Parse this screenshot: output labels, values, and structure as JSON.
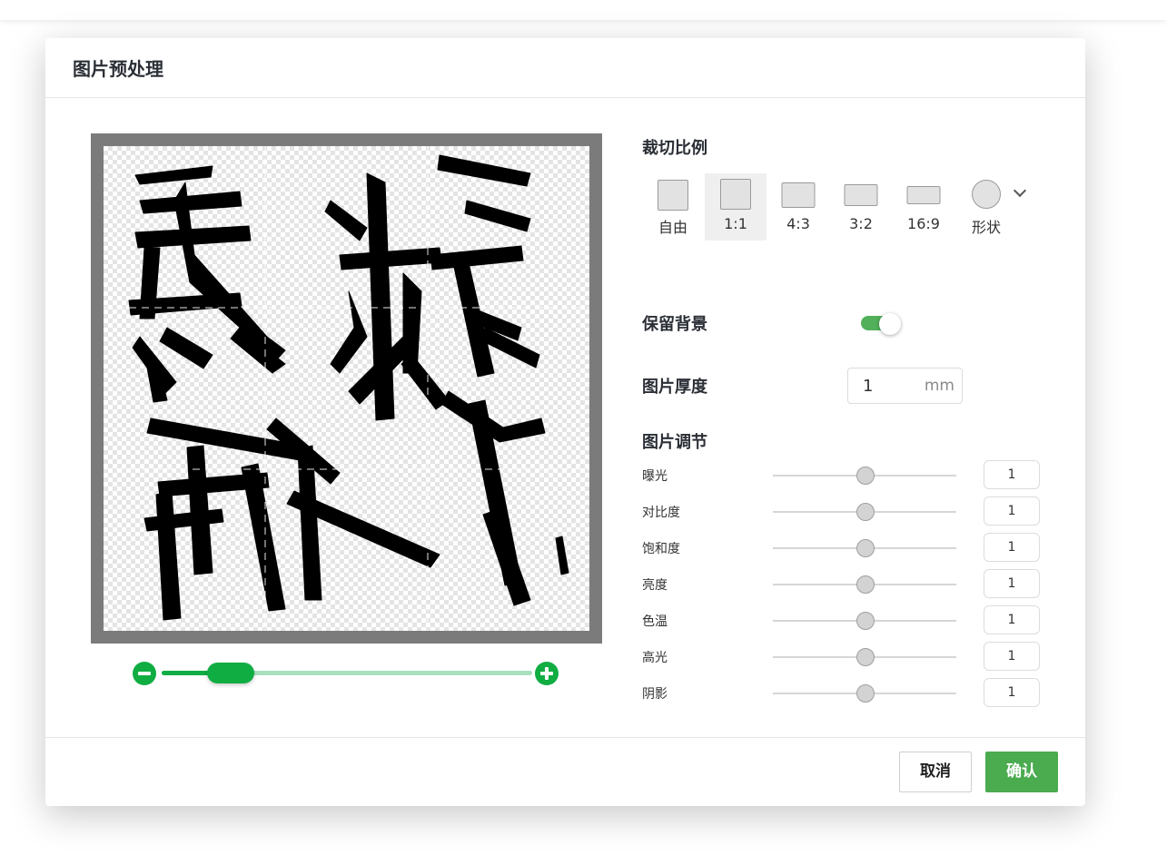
{
  "dialog": {
    "title": "图片预处理"
  },
  "crop": {
    "title": "裁切比例",
    "options": [
      {
        "label": "自由",
        "selected": false
      },
      {
        "label": "1:1",
        "selected": true
      },
      {
        "label": "4:3",
        "selected": false
      },
      {
        "label": "3:2",
        "selected": false
      },
      {
        "label": "16:9",
        "selected": false
      },
      {
        "label": "形状",
        "selected": false
      }
    ]
  },
  "background": {
    "label": "保留背景",
    "enabled": true
  },
  "thickness": {
    "label": "图片厚度",
    "value": "1",
    "unit": "mm"
  },
  "adjust": {
    "title": "图片调节",
    "items": [
      {
        "label": "曝光",
        "value": "1"
      },
      {
        "label": "对比度",
        "value": "1"
      },
      {
        "label": "饱和度",
        "value": "1"
      },
      {
        "label": "亮度",
        "value": "1"
      },
      {
        "label": "色温",
        "value": "1"
      },
      {
        "label": "高光",
        "value": "1"
      },
      {
        "label": "阴影",
        "value": "1"
      }
    ]
  },
  "zoom": {
    "level": 0.14
  },
  "footer": {
    "cancel_label": "取消",
    "confirm_label": "确认"
  },
  "colors": {
    "accent": "#10ad43",
    "confirm": "#4aab4f",
    "toggle": "#52b05a"
  }
}
